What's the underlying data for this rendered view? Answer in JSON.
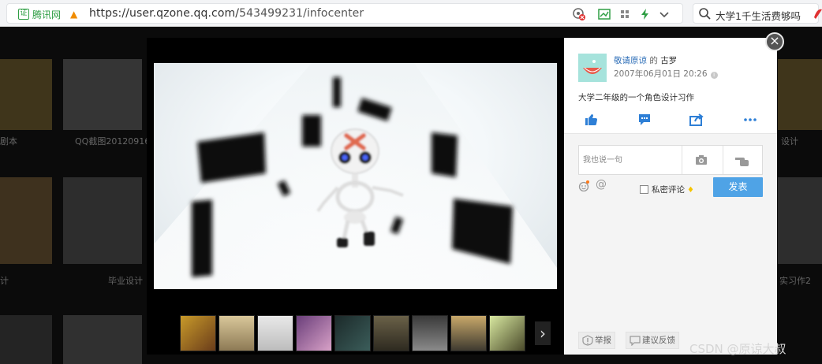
{
  "browser": {
    "site_name": "腾讯网",
    "url_host": "https://user.qzone.qq.com/",
    "url_path": "543499231/infocenter",
    "search_text": "大学1千生活费够吗"
  },
  "background": {
    "captions": [
      "剧本",
      "QQ截图20120916",
      "毕业设计",
      "计",
      "实习作2",
      "设计"
    ]
  },
  "viewer": {
    "filmstrip_count": 9,
    "next_label": "›"
  },
  "panel": {
    "author": "敬请原谅",
    "author_sep": " 的 ",
    "album": "古罗",
    "time": "2007年06月01日 20:26",
    "info_mark": "i",
    "description": "大学二年级的一个角色设计习作",
    "comment_placeholder": "我也说一句",
    "private_label": "私密评论",
    "send_label": "发表",
    "report_label": "举报",
    "feedback_label": "建议反馈",
    "close_label": "×"
  },
  "watermark": "CSDN @原谅大叔",
  "colors": {
    "accent": "#4fa3e6",
    "link": "#2f6fb8",
    "icon_blue": "#2e7fd6"
  }
}
